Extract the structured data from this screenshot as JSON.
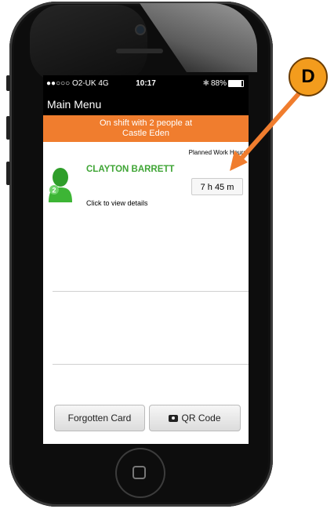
{
  "status_bar": {
    "carrier": "●●○○○ O2-UK  4G",
    "time": "10:17",
    "battery_percent": "88%"
  },
  "nav": {
    "title": "Main Menu"
  },
  "banner": {
    "text": "On shift with 2 people at Castle Eden"
  },
  "worker": {
    "column_header": "Planned Work Hours L",
    "name": "CLAYTON BARRETT",
    "avatar_number": "2",
    "planned_hours": "7 h 45 m",
    "details_link": "Click to view details"
  },
  "buttons": {
    "forgotten_card": "Forgotten Card",
    "qr_code": "QR Code"
  },
  "annotation": {
    "label": "D"
  },
  "colors": {
    "banner": "#f07d2e",
    "name_green": "#3fa535",
    "annotation_orange": "#f39c1d"
  }
}
